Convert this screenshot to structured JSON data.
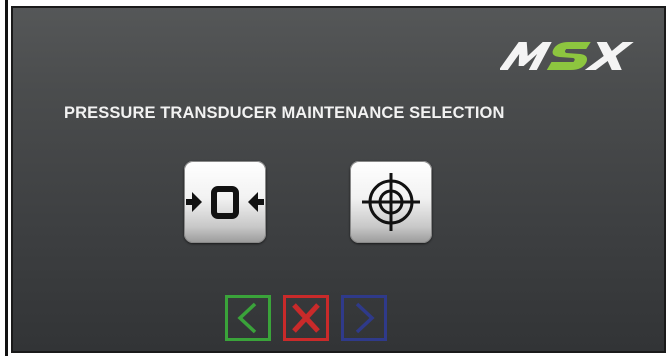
{
  "brand": {
    "logo_text": "MSX",
    "logo_colors": [
      "#ffffff",
      "#8dc63f",
      "#ffffff"
    ]
  },
  "screen": {
    "title": "PRESSURE TRANSDUCER MAINTENANCE SELECTION"
  },
  "tiles": [
    {
      "icon": "zero-calibration-icon",
      "glyph": "0"
    },
    {
      "icon": "crosshair-target-icon"
    }
  ],
  "nav": {
    "back": {
      "icon": "chevron-left-icon",
      "color": "#3aa33a"
    },
    "cancel": {
      "icon": "x-cancel-icon",
      "color": "#c92a2a"
    },
    "next": {
      "icon": "chevron-right-icon",
      "color": "#2f3a8a"
    }
  }
}
